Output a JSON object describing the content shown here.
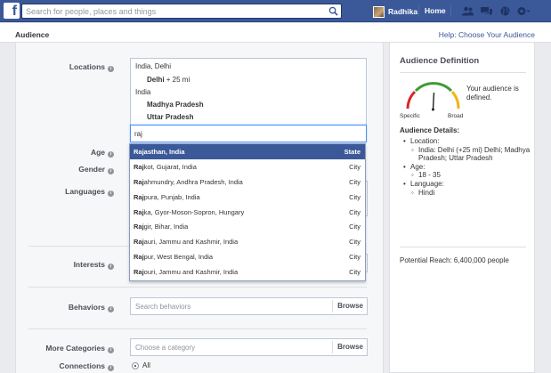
{
  "topbar": {
    "search_placeholder": "Search for people, places and things",
    "user_name": "Radhika",
    "home": "Home",
    "icons": [
      "friends-icon",
      "messages-icon",
      "globe-icon",
      "settings-icon"
    ]
  },
  "header": {
    "title": "Audience",
    "help": "Help: Choose Your Audience"
  },
  "form": {
    "locations_label": "Locations",
    "locations": [
      {
        "text": "India, Delhi",
        "bold": false
      },
      {
        "text": "Delhi",
        "suffix": " + 25 mi",
        "bold": true
      },
      {
        "text": "India",
        "bold": false
      },
      {
        "text": "Madhya Pradesh",
        "bold": true
      },
      {
        "text": "Uttar Pradesh",
        "bold": true
      }
    ],
    "location_input": "raj",
    "age_label": "Age",
    "gender_label": "Gender",
    "languages_label": "Languages",
    "interests_label": "Interests",
    "behaviors_label": "Behaviors",
    "behaviors_placeholder": "Search behaviors",
    "browse": "Browse",
    "more_categories_label": "More Categories",
    "categories_placeholder": "Choose a category",
    "connections_label": "Connections",
    "connections_value": "All"
  },
  "dropdown": [
    {
      "match": "Rajasthan, India",
      "rest": "",
      "type": "State",
      "selected": true
    },
    {
      "match": "Raj",
      "rest": "kot, Gujarat, India",
      "type": "City",
      "selected": false
    },
    {
      "match": "Raj",
      "rest": "ahmundry, Andhra Pradesh, India",
      "type": "City",
      "selected": false
    },
    {
      "match": "Raj",
      "rest": "pura, Punjab, India",
      "type": "City",
      "selected": false
    },
    {
      "match": "Raj",
      "rest": "ka, Gyor-Moson-Sopron, Hungary",
      "type": "City",
      "selected": false
    },
    {
      "match": "Raj",
      "rest": "gir, Bihar, India",
      "type": "City",
      "selected": false
    },
    {
      "match": "Raj",
      "rest": "auri, Jammu and Kashmir, India",
      "type": "City",
      "selected": false
    },
    {
      "match": "Raj",
      "rest": "pur, West Bengal, India",
      "type": "City",
      "selected": false
    },
    {
      "match": "Raj",
      "rest": "ouri, Jammu and Kashmir, India",
      "type": "City",
      "selected": false
    }
  ],
  "side": {
    "title": "Audience Definition",
    "gauge_specific": "Specific",
    "gauge_broad": "Broad",
    "defined_text": "Your audience is defined.",
    "details_title": "Audience Details:",
    "details": [
      {
        "label": "Location:",
        "items": [
          "India: Delhi (+25 mi) Delhi; Madhya Pradesh; Uttar Pradesh"
        ]
      },
      {
        "label": "Age:",
        "items": [
          "18 - 35"
        ]
      },
      {
        "label": "Language:",
        "items": [
          "Hindi"
        ]
      }
    ],
    "reach": "Potential Reach: 6,400,000 people"
  },
  "colors": {
    "brand": "#3b5998",
    "selected_row": "#3b5998",
    "gauge_red": "#d9262a",
    "gauge_yellow": "#f2b417",
    "gauge_green": "#3e9c35"
  }
}
